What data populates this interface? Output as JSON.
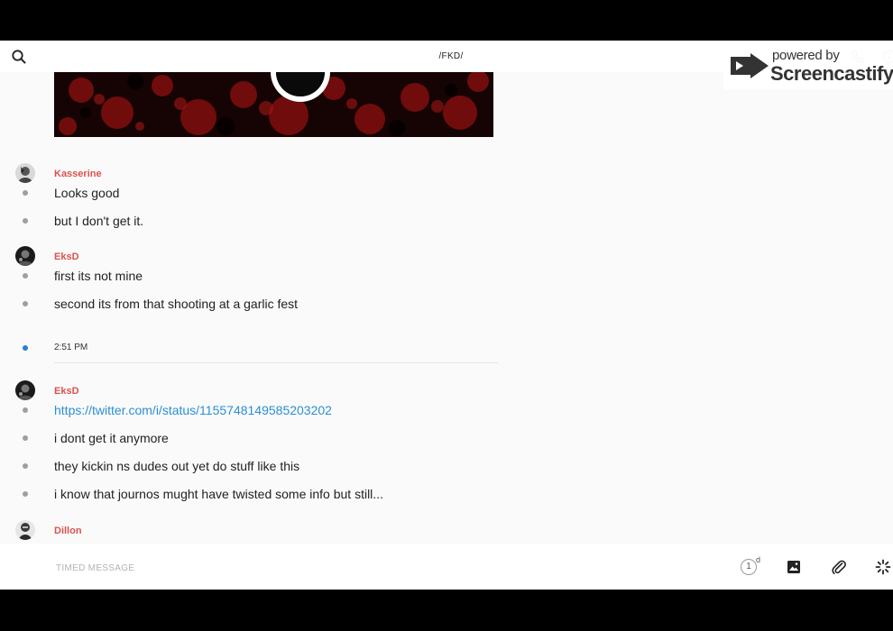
{
  "window": {
    "channel_title": "/FKD/"
  },
  "watermark": {
    "powered_by": "powered by",
    "brand": "Screencastify"
  },
  "messages": [
    {
      "author": "Kasserine",
      "lines": [
        "Looks good",
        "but I don't get it."
      ]
    },
    {
      "author": "EksD",
      "lines": [
        "first its not mine",
        "second its from that shooting at a garlic fest"
      ]
    },
    {
      "timestamp": "2:51 PM"
    },
    {
      "author": "EksD",
      "lines": [
        "https://twitter.com/i/status/1155748149585203202",
        "i dont get it anymore",
        "they kickin ns dudes out yet do stuff like this",
        "i know that journos mught have twisted some info but still..."
      ]
    },
    {
      "author": "Dillon",
      "lines": []
    }
  ],
  "composer": {
    "placeholder": "TIMED MESSAGE",
    "timer_value": "1",
    "timer_unit": "d"
  },
  "colors": {
    "author": "#d9534f",
    "link": "#2b8fd4",
    "timestamp_dot": "#2b7fd4"
  }
}
